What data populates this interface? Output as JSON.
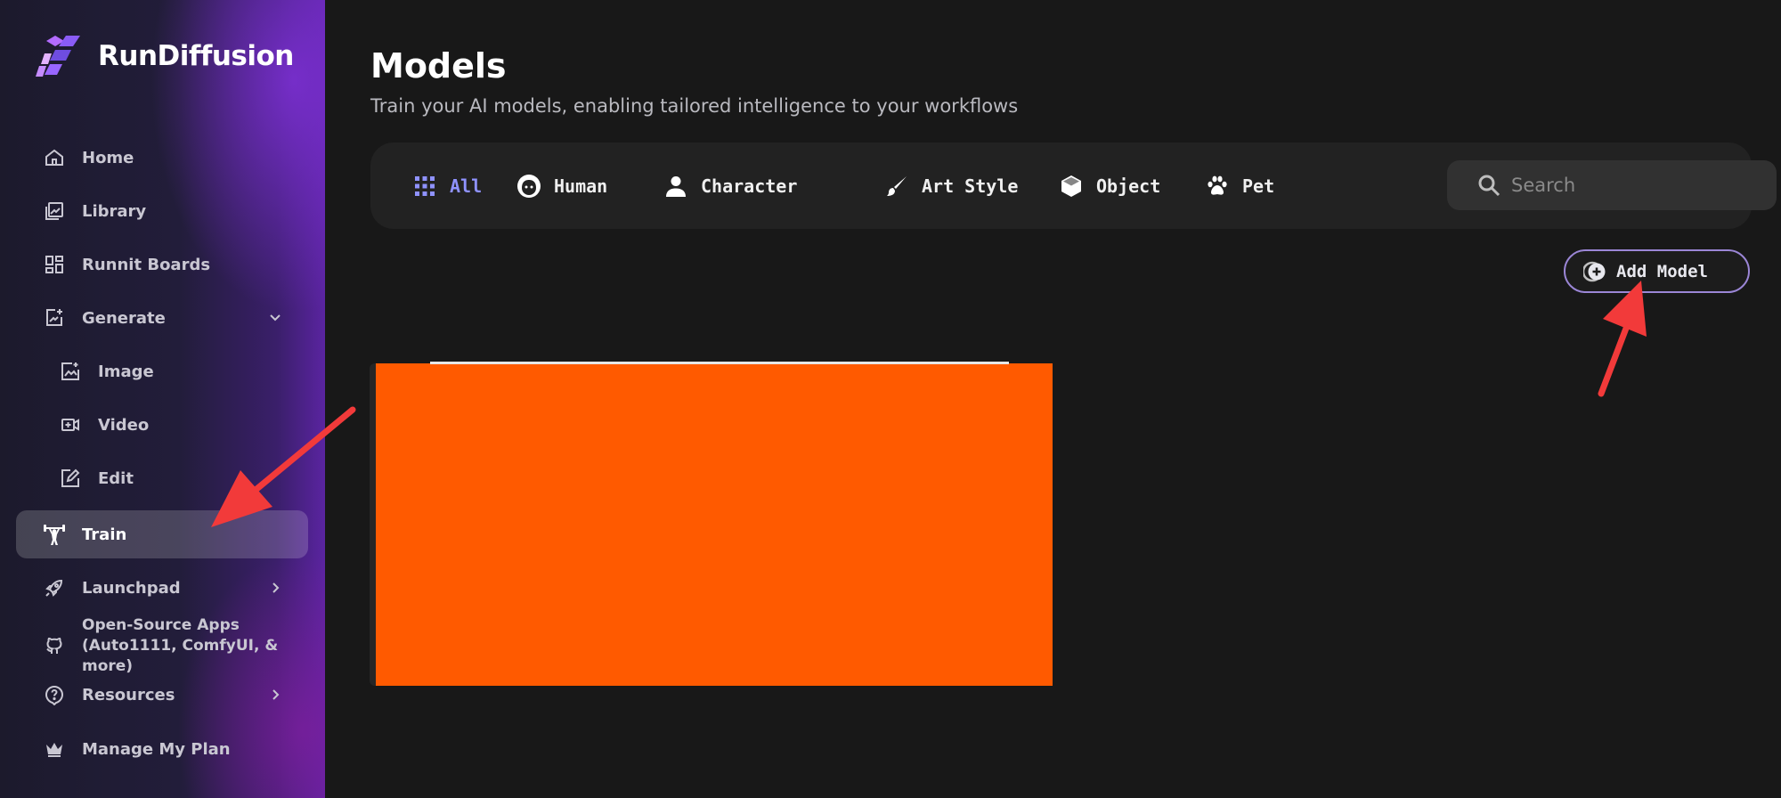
{
  "app": {
    "brand_name": "RunDiffusion"
  },
  "sidebar": {
    "items": [
      {
        "label": "Home",
        "icon": "home-icon"
      },
      {
        "label": "Library",
        "icon": "library-icon"
      },
      {
        "label": "Runnit Boards",
        "icon": "dashboard-icon"
      },
      {
        "label": "Generate",
        "icon": "generate-icon",
        "expanded": true
      },
      {
        "label": "Image",
        "icon": "image-icon"
      },
      {
        "label": "Video",
        "icon": "video-icon"
      },
      {
        "label": "Edit",
        "icon": "edit-icon"
      },
      {
        "label": "Train",
        "icon": "weightlifter-icon",
        "active": true
      },
      {
        "label": "Launchpad",
        "icon": "rocket-icon"
      },
      {
        "label_line1": "Open-Source Apps",
        "label_line2": "(Auto1111, ComfyUI, & more)",
        "icon": "github-icon"
      },
      {
        "label": "Resources",
        "icon": "help-icon"
      },
      {
        "label": "Manage My Plan",
        "icon": "crown-icon"
      }
    ]
  },
  "main": {
    "title": "Models",
    "subtitle": "Train your AI models, enabling tailored intelligence to your workflows",
    "filters": [
      {
        "label": "All",
        "icon": "grid-icon",
        "active": true
      },
      {
        "label": "Human",
        "icon": "face-icon"
      },
      {
        "label": "Character",
        "icon": "person-icon"
      },
      {
        "label": "Art Style",
        "icon": "brush-icon"
      },
      {
        "label": "Object",
        "icon": "cube-icon"
      },
      {
        "label": "Pet",
        "icon": "paw-icon"
      }
    ],
    "search": {
      "placeholder": "Search",
      "value": ""
    },
    "add_model_label": "Add Model"
  },
  "colors": {
    "accent": "#8f92ff",
    "card_redaction": "#ff5a00",
    "annotation_arrow": "#f23a3a",
    "add_model_border": "#9b86d6"
  }
}
